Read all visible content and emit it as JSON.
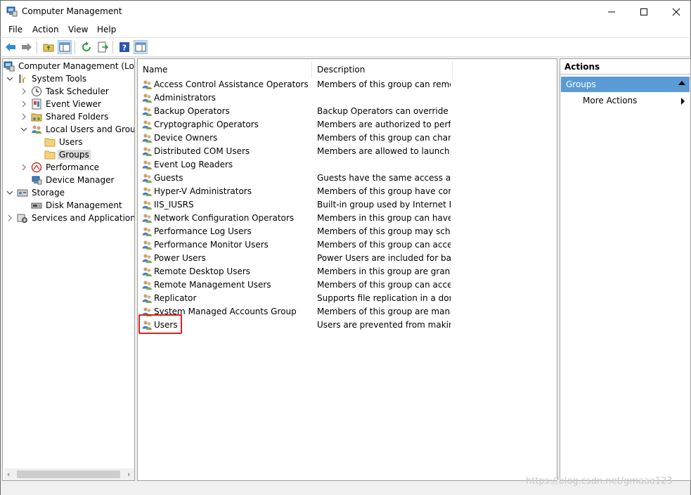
{
  "window": {
    "title": "Computer Management",
    "icon": "computer-management-icon"
  },
  "menu": [
    "File",
    "Action",
    "View",
    "Help"
  ],
  "toolbar": {
    "buttons": [
      "back-arrow-icon",
      "forward-arrow-icon",
      "up-folder-icon",
      "show-hide-tree-icon",
      "refresh-icon",
      "export-list-icon",
      "help-icon",
      "show-hide-action-pane-icon"
    ]
  },
  "tree": {
    "root": "Computer Management (Local",
    "items": [
      {
        "label": "Computer Management (Local",
        "icon": "computer-management-icon"
      },
      {
        "label": "System Tools",
        "icon": "system-tools-icon"
      },
      {
        "label": "Task Scheduler",
        "icon": "clock-icon"
      },
      {
        "label": "Event Viewer",
        "icon": "event-viewer-icon"
      },
      {
        "label": "Shared Folders",
        "icon": "shared-folder-icon"
      },
      {
        "label": "Local Users and Groups",
        "icon": "users-groups-icon"
      },
      {
        "label": "Users",
        "icon": "folder-icon"
      },
      {
        "label": "Groups",
        "icon": "folder-icon"
      },
      {
        "label": "Performance",
        "icon": "performance-icon"
      },
      {
        "label": "Device Manager",
        "icon": "device-manager-icon"
      },
      {
        "label": "Storage",
        "icon": "storage-icon"
      },
      {
        "label": "Disk Management",
        "icon": "disk-icon"
      },
      {
        "label": "Services and Applications",
        "icon": "services-icon"
      }
    ]
  },
  "list": {
    "columns": [
      "Name",
      "Description"
    ],
    "rows": [
      {
        "name": "Access Control Assistance Operators",
        "desc": "Members of this group can remot..."
      },
      {
        "name": "Administrators",
        "desc": ""
      },
      {
        "name": "Backup Operators",
        "desc": "Backup Operators can override se..."
      },
      {
        "name": "Cryptographic Operators",
        "desc": "Members are authorized to perfor..."
      },
      {
        "name": "Device Owners",
        "desc": "Members of this group can chang..."
      },
      {
        "name": "Distributed COM Users",
        "desc": "Members are allowed to launch, a..."
      },
      {
        "name": "Event Log Readers",
        "desc": ""
      },
      {
        "name": "Guests",
        "desc": "Guests have the same access as m..."
      },
      {
        "name": "Hyper-V Administrators",
        "desc": "Members of this group have com..."
      },
      {
        "name": "IIS_IUSRS",
        "desc": "Built-in group used by Internet Inf..."
      },
      {
        "name": "Network Configuration Operators",
        "desc": "Members in this group can have s..."
      },
      {
        "name": "Performance Log Users",
        "desc": "Members of this group may sche..."
      },
      {
        "name": "Performance Monitor Users",
        "desc": "Members of this group can acces..."
      },
      {
        "name": "Power Users",
        "desc": "Power Users are included for back..."
      },
      {
        "name": "Remote Desktop Users",
        "desc": "Members in this group are grante..."
      },
      {
        "name": "Remote Management Users",
        "desc": "Members of this group can acces..."
      },
      {
        "name": "Replicator",
        "desc": "Supports file replication in a dom..."
      },
      {
        "name": "System Managed Accounts Group",
        "desc": "Members of this group are mana..."
      },
      {
        "name": "Users",
        "desc": "Users are prevented from making ..."
      }
    ]
  },
  "actions": {
    "header": "Actions",
    "group": "Groups",
    "items": [
      "More Actions"
    ]
  },
  "watermark": "https://blog.csdn.net/gmaaa123",
  "colors": {
    "selection_bar": "#5b9bd5",
    "highlight_box": "#e02020"
  }
}
